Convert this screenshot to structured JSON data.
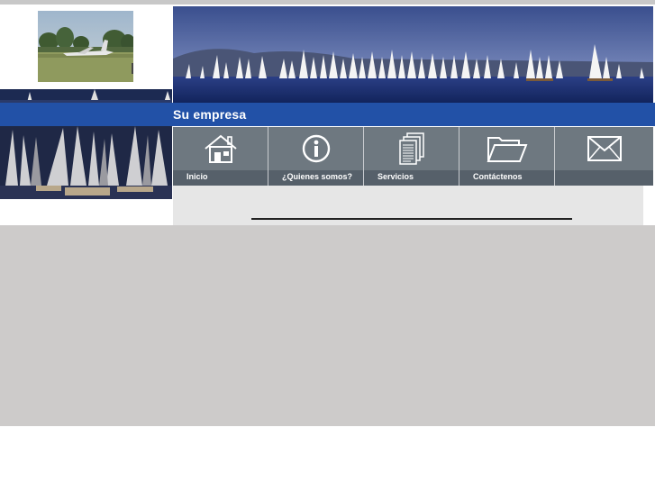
{
  "header": {
    "company_name": "Su empresa"
  },
  "nav": {
    "items": [
      {
        "label": "Inicio",
        "icon": "house-icon"
      },
      {
        "label": "¿Quienes somos?",
        "icon": "info-icon"
      },
      {
        "label": "Servicios",
        "icon": "documents-icon"
      },
      {
        "label": "Contáctenos",
        "icon": "folder-icon"
      },
      {
        "label": "",
        "icon": "envelope-icon"
      }
    ]
  },
  "colors": {
    "accent_blue": "#2251a7",
    "nav_gray": "#6e7880",
    "nav_label_bar": "#56606a",
    "page_gray": "#cdcbca"
  }
}
